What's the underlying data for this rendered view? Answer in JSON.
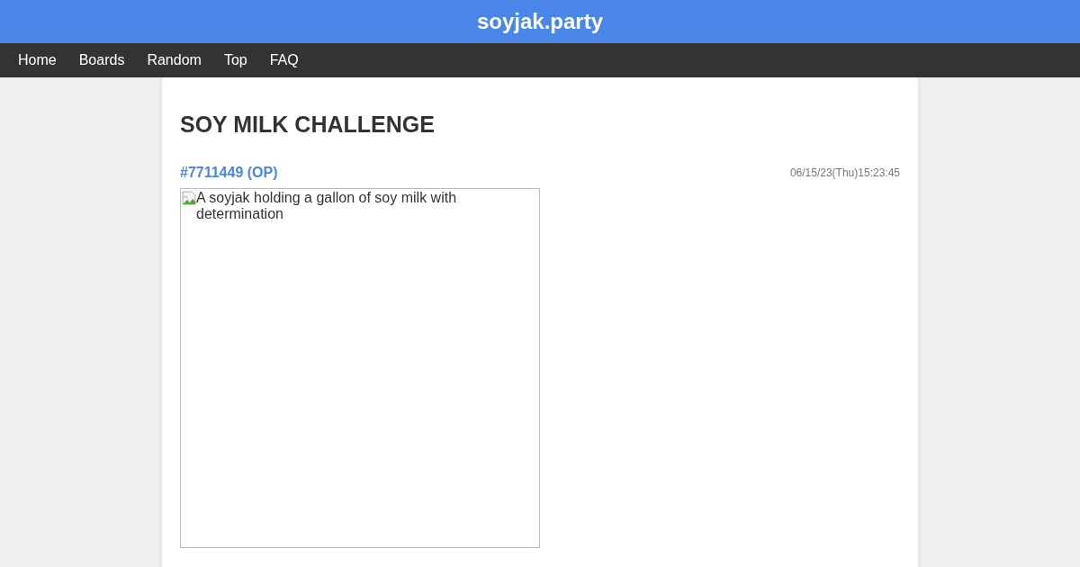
{
  "site_title": "soyjak.party",
  "nav": [
    {
      "label": "Home"
    },
    {
      "label": "Boards"
    },
    {
      "label": "Random"
    },
    {
      "label": "Top"
    },
    {
      "label": "FAQ"
    }
  ],
  "thread": {
    "title": "SOY MILK CHALLENGE",
    "post": {
      "number": "#7711449 (OP)",
      "date": "06/15/23(Thu)15:23:45",
      "image_alt": "A soyjak holding a gallon of soy milk with determination"
    }
  }
}
